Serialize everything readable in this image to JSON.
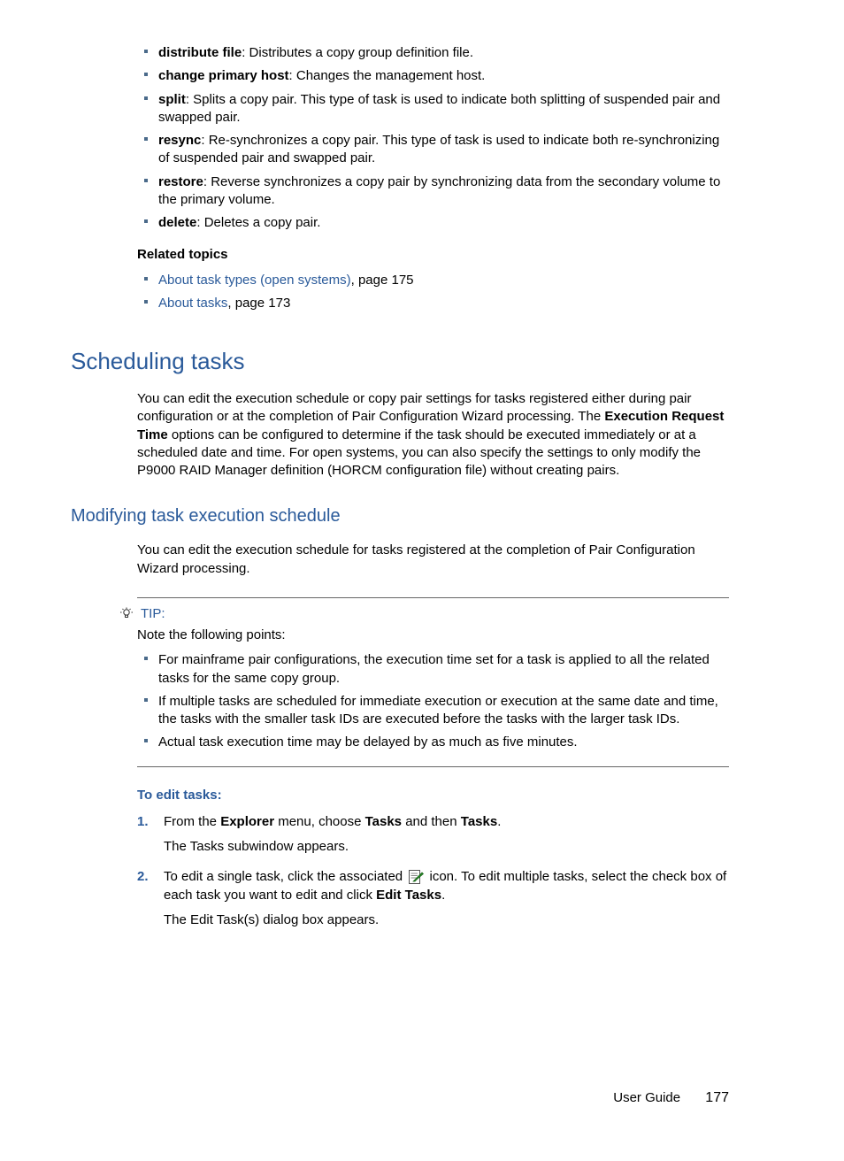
{
  "bullets": [
    {
      "term": "distribute file",
      "desc": ": Distributes a copy group definition file."
    },
    {
      "term": "change primary host",
      "desc": ": Changes the management host."
    },
    {
      "term": "split",
      "desc": ": Splits a copy pair. This type of task is used to indicate both splitting of suspended pair and swapped pair."
    },
    {
      "term": "resync",
      "desc": ": Re-synchronizes a copy pair. This type of task is used to indicate both re-synchronizing of suspended pair and swapped pair."
    },
    {
      "term": "restore",
      "desc": ": Reverse synchronizes a copy pair by synchronizing data from the secondary volume to the primary volume."
    },
    {
      "term": "delete",
      "desc": ": Deletes a copy pair."
    }
  ],
  "related": {
    "heading": "Related topics",
    "items": [
      {
        "link": "About task types (open systems)",
        "rest": ", page 175"
      },
      {
        "link": "About tasks",
        "rest": ", page 173"
      }
    ]
  },
  "section": {
    "title": "Scheduling tasks",
    "para_a": "You can edit the execution schedule or copy pair settings for tasks registered either during pair configuration or at the completion of Pair Configuration Wizard processing. The ",
    "para_bold": "Execution Request Time",
    "para_b": " options can be configured to determine if the task should be executed immediately or at a scheduled date and time. For open systems, you can also specify the settings to only modify the P9000 RAID Manager definition (HORCM configuration file) without creating pairs."
  },
  "subsection": {
    "title": "Modifying task execution schedule",
    "para": "You can edit the execution schedule for tasks registered at the completion of Pair Configuration Wizard processing."
  },
  "tip": {
    "label": "TIP:",
    "intro": "Note the following points:",
    "items": [
      "For mainframe pair configurations, the execution time set for a task is applied to all the related tasks for the same copy group.",
      "If multiple tasks are scheduled for immediate execution or execution at the same date and time, the tasks with the smaller task IDs are executed before the tasks with the larger task IDs.",
      "Actual task execution time may be delayed by as much as five minutes."
    ]
  },
  "steps": {
    "heading": "To edit tasks:",
    "step1": {
      "a": "From the ",
      "b1": "Explorer",
      "c": " menu, choose ",
      "b2": "Tasks",
      "d": " and then ",
      "b3": "Tasks",
      "e": ".",
      "sub": "The Tasks subwindow appears."
    },
    "step2": {
      "a": "To edit a single task, click the associated ",
      "b": " icon. To edit multiple tasks, select the check box of each task you want to edit and click ",
      "bold": "Edit Tasks",
      "c": ".",
      "sub": "The Edit Task(s) dialog box appears."
    }
  },
  "footer": {
    "label": "User Guide",
    "page": "177"
  }
}
